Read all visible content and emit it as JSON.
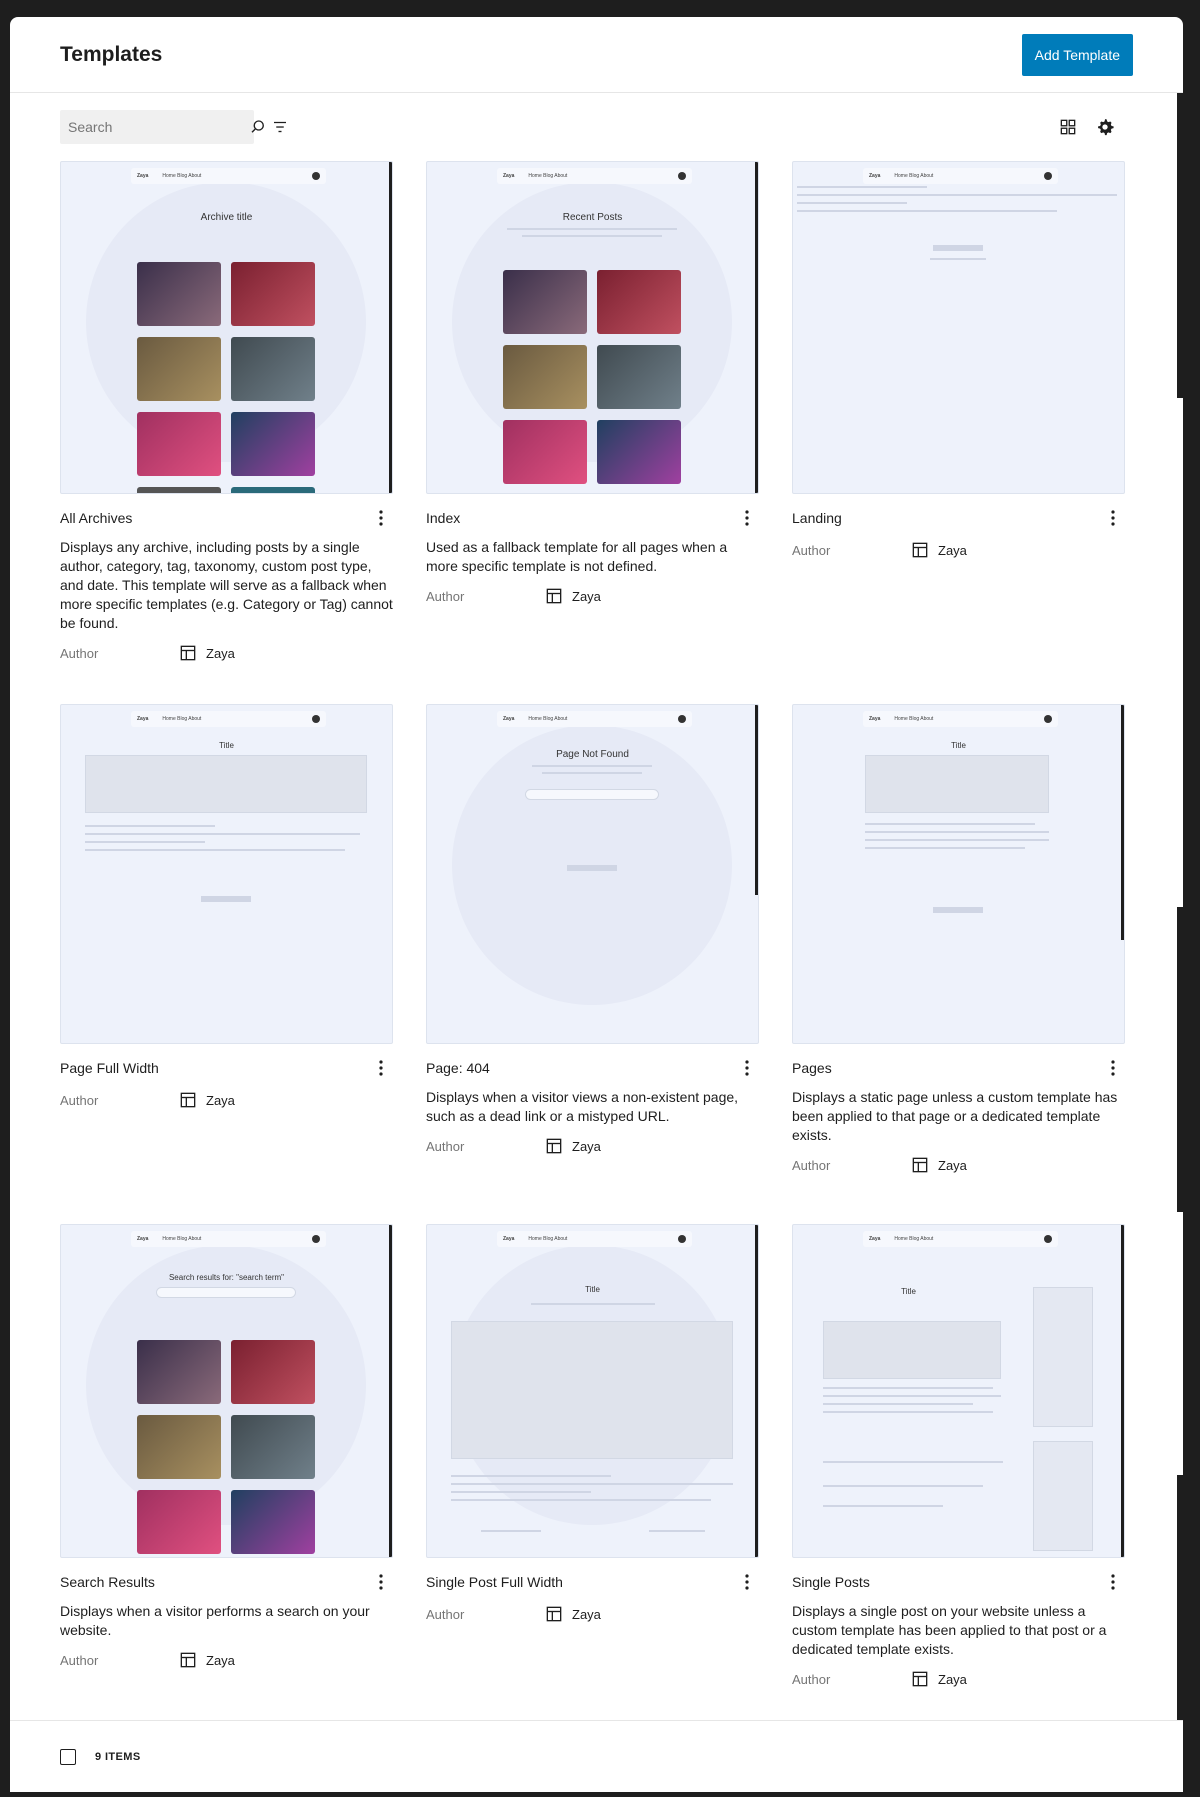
{
  "header": {
    "title": "Templates",
    "add_button": "Add Template"
  },
  "toolbar": {
    "search_placeholder": "Search"
  },
  "templates": [
    {
      "title": "All Archives",
      "description": "Displays any archive, including posts by a single author, category, tag, taxonomy, custom post type, and date. This template will serve as a fallback when more specific templates (e.g. Category or Tag) cannot be found.",
      "author_label": "Author",
      "author": "Zaya",
      "preview_title": "Archive title"
    },
    {
      "title": "Index",
      "description": "Used as a fallback template for all pages when a more specific template is not defined.",
      "author_label": "Author",
      "author": "Zaya",
      "preview_title": "Recent Posts"
    },
    {
      "title": "Landing",
      "description": "",
      "author_label": "Author",
      "author": "Zaya",
      "preview_title": ""
    },
    {
      "title": "Page Full Width",
      "description": "",
      "author_label": "Author",
      "author": "Zaya",
      "preview_title": "Title"
    },
    {
      "title": "Page: 404",
      "description": "Displays when a visitor views a non-existent page, such as a dead link or a mistyped URL.",
      "author_label": "Author",
      "author": "Zaya",
      "preview_title": "Page Not Found"
    },
    {
      "title": "Pages",
      "description": "Displays a static page unless a custom template has been applied to that page or a dedicated template exists.",
      "author_label": "Author",
      "author": "Zaya",
      "preview_title": "Title"
    },
    {
      "title": "Search Results",
      "description": "Displays when a visitor performs a search on your website.",
      "author_label": "Author",
      "author": "Zaya",
      "preview_title": "Search results for: \"search term\""
    },
    {
      "title": "Single Post Full Width",
      "description": "",
      "author_label": "Author",
      "author": "Zaya",
      "preview_title": "Title"
    },
    {
      "title": "Single Posts",
      "description": "Displays a single post on your website unless a custom template has been applied to that post or a dedicated template exists.",
      "author_label": "Author",
      "author": "Zaya",
      "preview_title": "Title"
    }
  ],
  "preview_nav": {
    "brand": "Zaya",
    "links": "Home  Blog  About"
  },
  "footer": {
    "count_label": "9 ITEMS"
  },
  "colors": {
    "accent": "#007cba",
    "preview_bg": "#eef2fb"
  }
}
